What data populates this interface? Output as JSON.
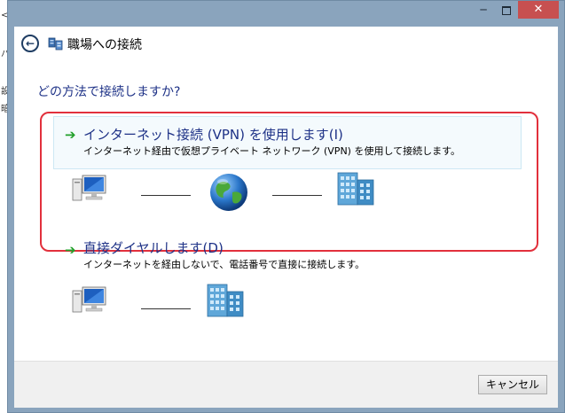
{
  "window": {
    "title": "職場への接続",
    "close_glyph": "✕",
    "minimize_glyph": "─",
    "back_glyph": "←",
    "back_icon": "back-arrow-icon",
    "title_icon": "network-connection-icon"
  },
  "background_window": {
    "glyphs": [
      "<",
      "バ",
      "設",
      "暗"
    ]
  },
  "main": {
    "question": "どの方法で接続しますか?",
    "options": [
      {
        "title": "インターネット接続 (VPN) を使用します(I)",
        "description": "インターネット経由で仮想プライベート ネットワーク (VPN) を使用して接続します。",
        "icons": [
          "computer-icon",
          "globe-icon",
          "office-building-icon"
        ],
        "highlighted": true
      },
      {
        "title": "直接ダイヤルします(D)",
        "description": "インターネットを経由しないで、電話番号で直接に接続します。",
        "icons": [
          "computer-icon",
          "office-building-icon"
        ],
        "highlighted": false
      }
    ]
  },
  "footer": {
    "cancel_label": "キャンセル"
  },
  "colors": {
    "accent_text": "#1e3287",
    "highlight_border": "#e2303c",
    "arrow_green": "#22a02a",
    "titlebar": "#8aa4bd",
    "close_button": "#c75050"
  }
}
